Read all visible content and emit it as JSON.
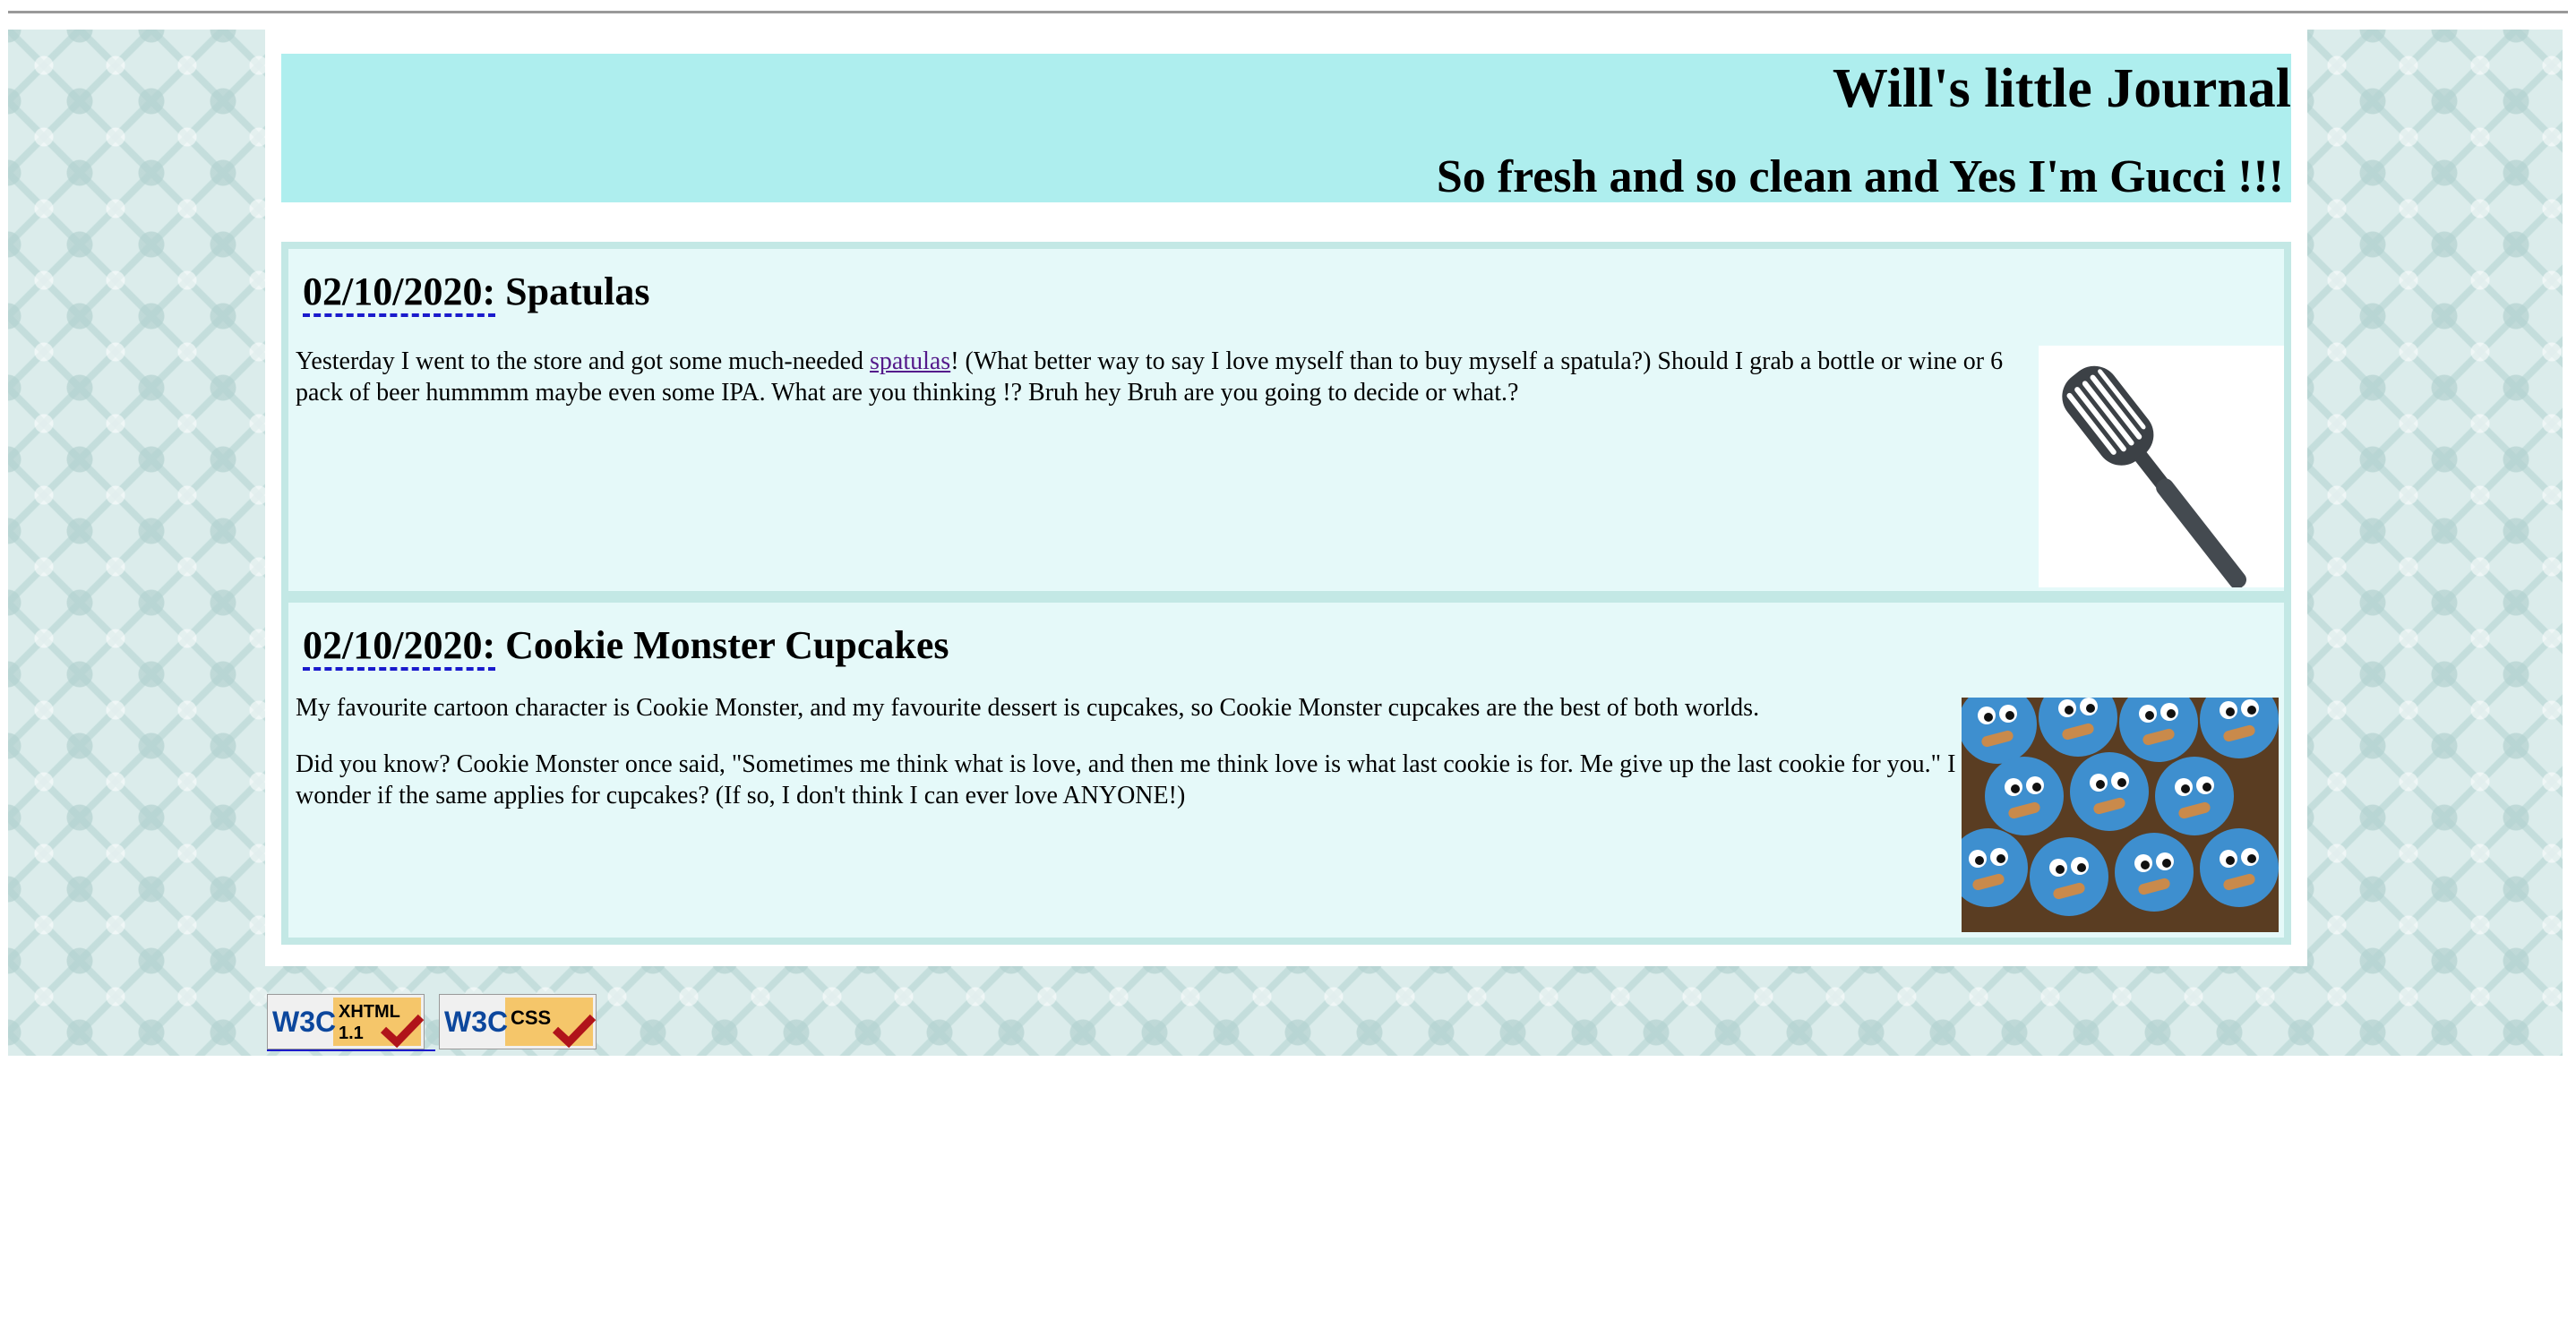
{
  "header": {
    "title": "Will's little Journal",
    "subtitle": "So fresh and so clean and Yes I'm Gucci !!!"
  },
  "entries": [
    {
      "date": "02/10/2020",
      "separator": ":",
      "title": "Spatulas",
      "paragraphs": [
        {
          "before_link": "Yesterday I went to the store and got some much-needed ",
          "link_text": "spatulas",
          "after_link": "! (What better way to say I love myself than to buy myself a spatula?) Should I grab a bottle or wine or 6 pack of beer hummmm maybe even some IPA. What are you thinking !? Bruh hey Bruh are you going to decide or what.?"
        }
      ],
      "image_icon": "spatula-image"
    },
    {
      "date": "02/10/2020",
      "separator": ":",
      "title": "Cookie Monster Cupcakes",
      "paragraphs": [
        {
          "text": "My favourite cartoon character is Cookie Monster, and my favourite dessert is cupcakes, so Cookie Monster cupcakes are the best of both worlds."
        },
        {
          "text": "Did you know? Cookie Monster once said, \"Sometimes me think what is love, and then me think love is what last cookie is for. Me give up the last cookie for you.\" I wonder if the same applies for cupcakes? (If so, I don't think I can ever love ANYONE!)"
        }
      ],
      "image_icon": "cookie-monster-cupcakes-image"
    }
  ],
  "footer": {
    "badges": [
      {
        "brand": "W3C",
        "label_line1": "XHTML",
        "label_line2": "1.1",
        "icon": "w3c-xhtml-valid-badge"
      },
      {
        "brand": "W3C",
        "label_line1": "CSS",
        "label_line2": "",
        "icon": "w3c-css-valid-badge"
      }
    ]
  },
  "colors": {
    "header_bg": "#aeeeee",
    "entry_bg": "#e5f9f9",
    "entry_border": "#c3e8e5",
    "pattern_bg": "#dbeceb",
    "visited_link": "#551a8b",
    "date_underline": "#1a1acc"
  }
}
